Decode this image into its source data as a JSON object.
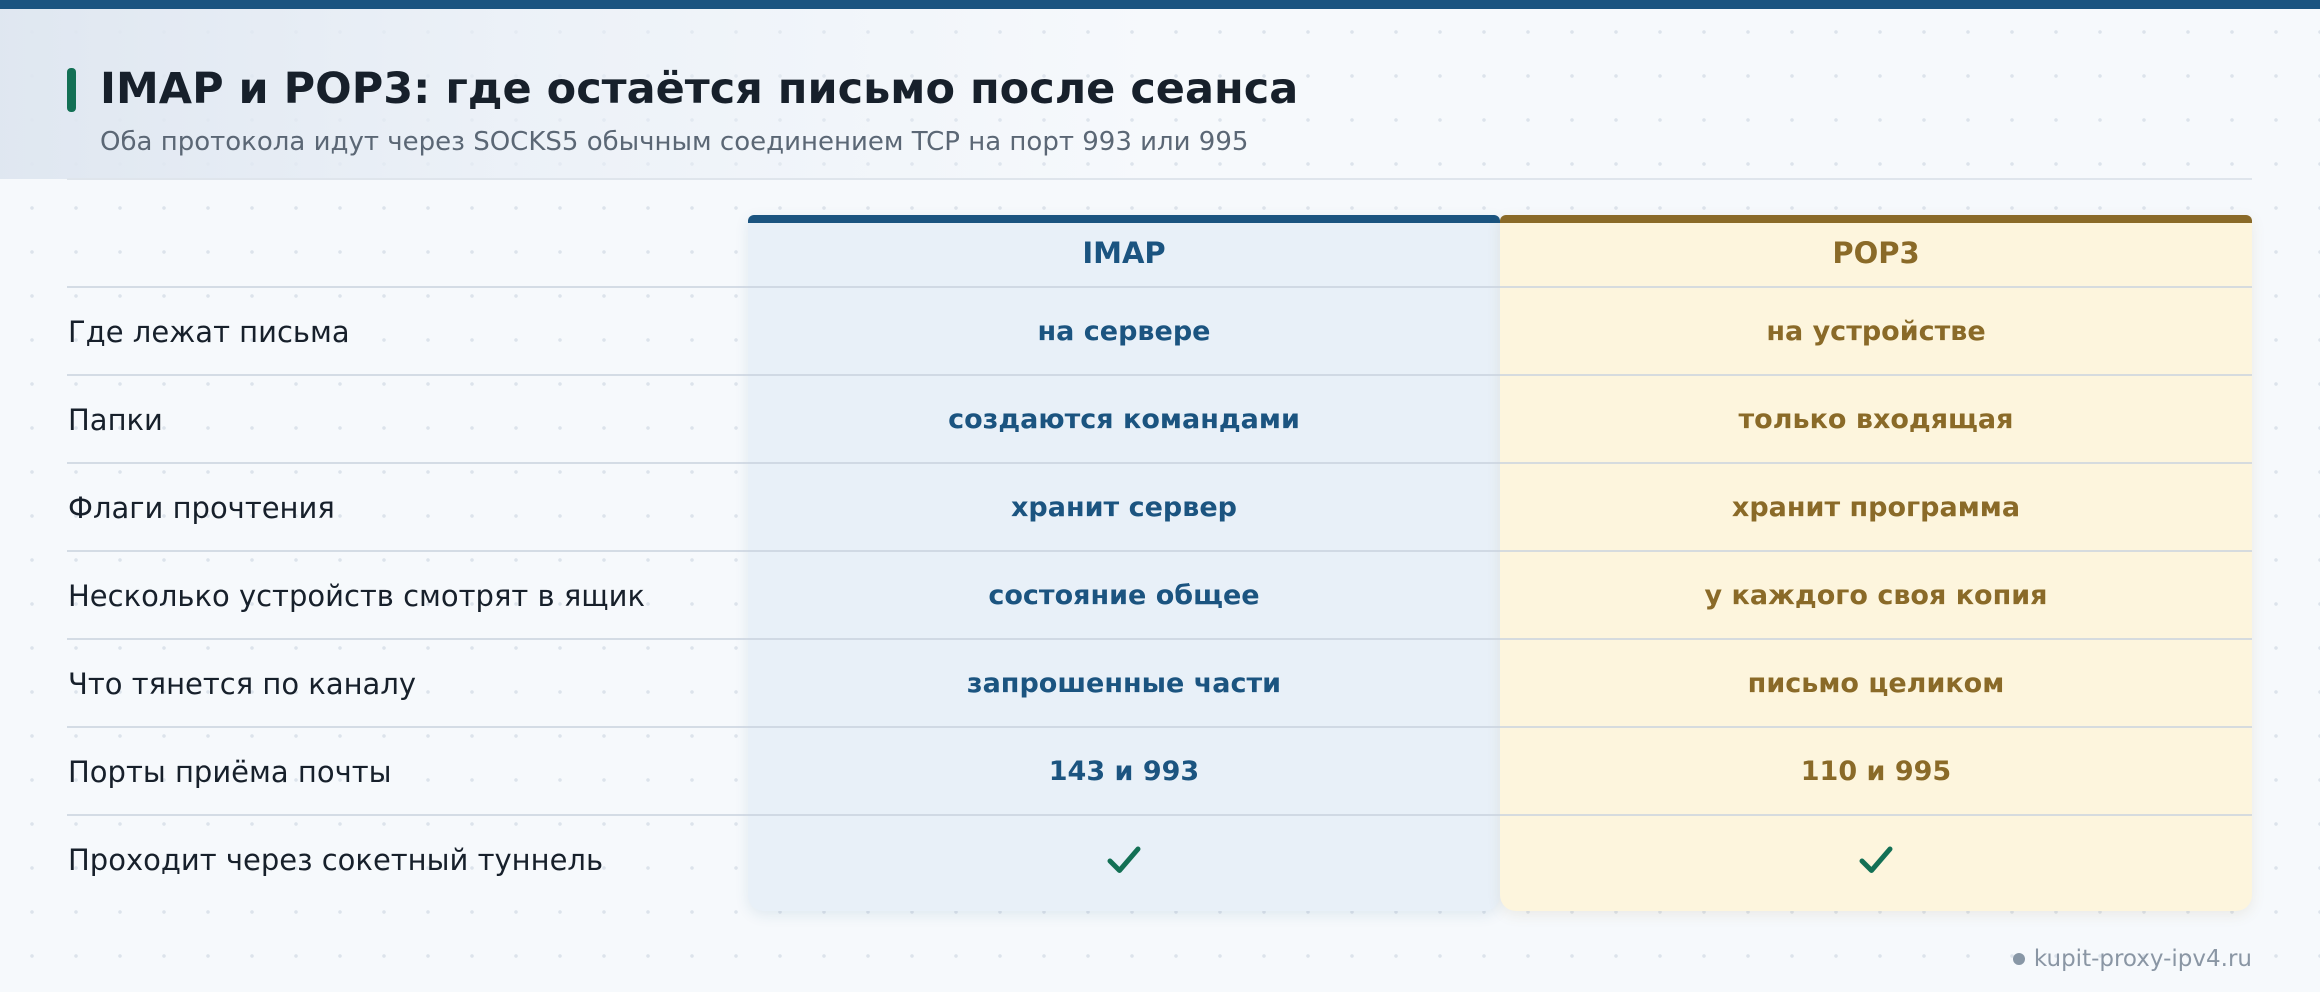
{
  "title": "IMAP и POP3: где остаётся письмо после сеанса",
  "subtitle": "Оба протокола идут через SOCKS5 обычным соединением TCP на порт 993 или 995",
  "columns": {
    "imap": {
      "label": "IMAP",
      "color": "#1b5480",
      "background": "#e8f0f8"
    },
    "pop3": {
      "label": "POP3",
      "color": "#8a6a28",
      "background": "#fdf5dd"
    }
  },
  "accent_color": "#137055",
  "rows": [
    {
      "label": "Где лежат письма",
      "imap": "на сервере",
      "pop3": "на устройстве"
    },
    {
      "label": "Папки",
      "imap": "создаются командами",
      "pop3": "только входящая"
    },
    {
      "label": "Флаги прочтения",
      "imap": "хранит сервер",
      "pop3": "хранит программа"
    },
    {
      "label": "Несколько устройств смотрят в ящик",
      "imap": "состояние общее",
      "pop3": "у каждого своя копия"
    },
    {
      "label": "Что тянется по каналу",
      "imap": "запрошенные части",
      "pop3": "письмо целиком"
    },
    {
      "label": "Порты приёма почты",
      "imap": "143 и 993",
      "pop3": "110 и 995"
    },
    {
      "label": "Проходит через сокетный туннель",
      "imap_icon": "checkmark-icon",
      "pop3_icon": "checkmark-icon"
    }
  ],
  "footer": {
    "site": "kupit-proxy-ipv4.ru"
  }
}
